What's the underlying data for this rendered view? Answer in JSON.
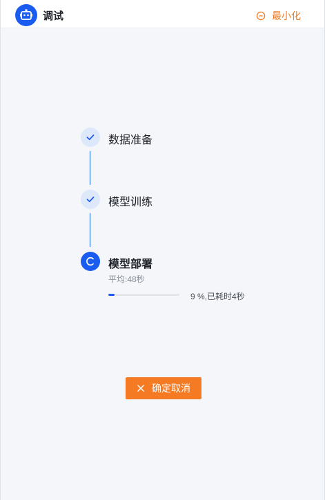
{
  "header": {
    "title": "调试",
    "minimize_label": "最小化",
    "avatar_icon": "robot-icon",
    "minimize_icon": "minus-circle-icon"
  },
  "colors": {
    "accent": "#1a5bf0",
    "done_bg": "#dde8fb",
    "warn": "#f57a24"
  },
  "steps": [
    {
      "label": "数据准备",
      "status": "done",
      "icon": "check-icon"
    },
    {
      "label": "模型训练",
      "status": "done",
      "icon": "check-icon"
    },
    {
      "label": "模型部署",
      "status": "active",
      "icon": "spinner-icon"
    }
  ],
  "deploy": {
    "average": "平均:48秒",
    "progress_percent": 9,
    "progress_text": "9 %,已耗时4秒"
  },
  "actions": {
    "cancel_label": "确定取消",
    "cancel_icon": "close-icon"
  }
}
